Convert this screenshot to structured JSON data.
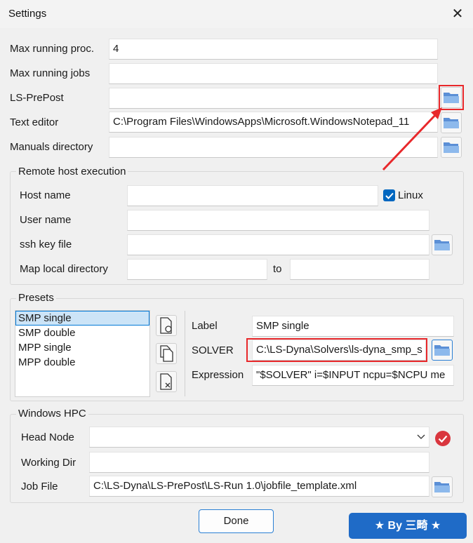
{
  "window": {
    "title": "Settings",
    "close_glyph": "✕"
  },
  "general": {
    "max_running_proc": {
      "label": "Max running proc.",
      "value": "4"
    },
    "max_running_jobs": {
      "label": "Max running jobs",
      "value": ""
    },
    "ls_prepost": {
      "label": "LS-PrePost",
      "value": ""
    },
    "text_editor": {
      "label": "Text editor",
      "value": "C:\\Program Files\\WindowsApps\\Microsoft.WindowsNotepad_11"
    },
    "manuals_directory": {
      "label": "Manuals directory",
      "value": ""
    }
  },
  "remote": {
    "title": "Remote host execution",
    "host_name": {
      "label": "Host name",
      "value": ""
    },
    "linux": {
      "label": "Linux",
      "checked": true
    },
    "user_name": {
      "label": "User name",
      "value": ""
    },
    "ssh_key_file": {
      "label": "ssh key file",
      "value": ""
    },
    "map_local_directory": {
      "label": "Map local directory",
      "value": "",
      "to_label": "to",
      "to_value": ""
    }
  },
  "presets": {
    "title": "Presets",
    "items": [
      "SMP single",
      "SMP double",
      "MPP single",
      "MPP double"
    ],
    "selected_index": 0,
    "label_field": {
      "label": "Label",
      "value": "SMP single"
    },
    "solver_field": {
      "label": "SOLVER",
      "value": "C:\\LS-Dyna\\Solvers\\ls-dyna_smp_s"
    },
    "expression_field": {
      "label": "Expression",
      "value": "\"$SOLVER\" i=$INPUT ncpu=$NCPU me"
    }
  },
  "hpc": {
    "title": "Windows HPC",
    "head_node": {
      "label": "Head Node",
      "value": ""
    },
    "working_dir": {
      "label": "Working Dir",
      "value": ""
    },
    "job_file": {
      "label": "Job File",
      "value": "C:\\LS-Dyna\\LS-PrePost\\LS-Run 1.0\\jobfile_template.xml"
    }
  },
  "footer": {
    "done_label": "Done",
    "badge_text": "★ By 三畸 ★"
  },
  "colors": {
    "accent": "#0067c0",
    "highlight": "#e8282b",
    "badge": "#1f6bc7",
    "status_ok": "#d9363e"
  }
}
